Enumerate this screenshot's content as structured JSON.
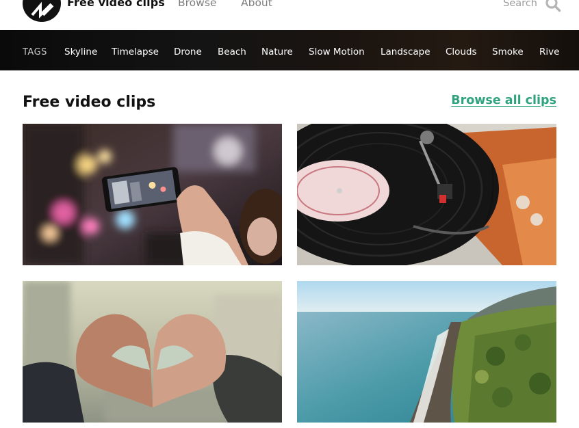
{
  "header": {
    "brand": "Free video clips",
    "nav": {
      "browse": "Browse",
      "about": "About"
    },
    "search": {
      "placeholder": "Search"
    },
    "icons": {
      "logo": "logo-mark",
      "search": "search-icon"
    }
  },
  "tagbar": {
    "label": "TAGS",
    "tags": [
      "Skyline",
      "Timelapse",
      "Drone",
      "Beach",
      "Nature",
      "Slow Motion",
      "Landscape",
      "Clouds",
      "Smoke",
      "Rive"
    ]
  },
  "main": {
    "title": "Free video clips",
    "browse_all": "Browse all clips",
    "clips": [
      {
        "subject": "phone filming city at night"
      },
      {
        "subject": "vinyl record player"
      },
      {
        "subject": "hands making heart shape"
      },
      {
        "subject": "aerial beach coastline"
      }
    ]
  },
  "colors": {
    "accent": "#2ea37e",
    "tagbar_bg": "#111111"
  }
}
